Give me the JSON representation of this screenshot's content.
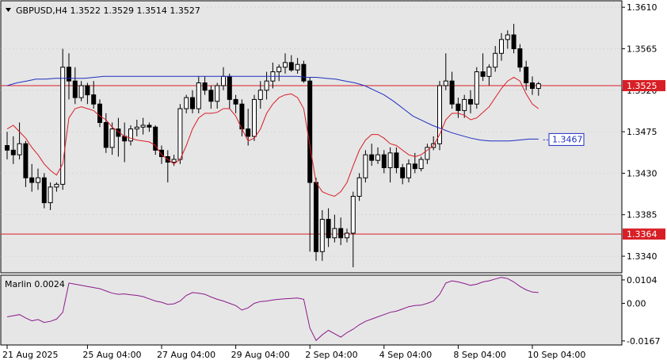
{
  "header": {
    "symbol_info": "GBPUSD,H4  1.3522 1.3529 1.3514 1.3527",
    "menu_icon": "triangle-down-icon"
  },
  "indicator": {
    "name": "Marlin 0.0024"
  },
  "colors": {
    "background": "#e6e6e6",
    "bull_candle": "#ffffff",
    "bear_candle": "#000000",
    "ma_blue": "#1f2fbf",
    "ma_red": "#d81f26",
    "hline": "#d81f26",
    "osc": "#8b1a8b",
    "grid": "#c8c8c8"
  },
  "chart_data": [
    {
      "type": "candlestick",
      "symbol": "GBPUSD",
      "timeframe": "H4",
      "ylim": [
        1.3322,
        1.3617
      ],
      "y_ticks": [
        "1.3610",
        "1.3565",
        "1.3520",
        "1.3475",
        "1.3430",
        "1.3385",
        "1.3340"
      ],
      "x_ticks": [
        {
          "label": "21 Aug 2025",
          "i": 0
        },
        {
          "label": "25 Aug 04:00",
          "i": 13
        },
        {
          "label": "27 Aug 04:00",
          "i": 25
        },
        {
          "label": "29 Aug 04:00",
          "i": 37
        },
        {
          "label": "2 Sep 04:00",
          "i": 49
        },
        {
          "label": "4 Sep 04:00",
          "i": 61
        },
        {
          "label": "8 Sep 04:00",
          "i": 73
        },
        {
          "label": "10 Sep 04:00",
          "i": 85
        }
      ],
      "candles": [
        [
          1.346,
          1.3475,
          1.3445,
          1.3455
        ],
        [
          1.3455,
          1.347,
          1.344,
          1.345
        ],
        [
          1.345,
          1.3485,
          1.3445,
          1.3462
        ],
        [
          1.3462,
          1.3465,
          1.3415,
          1.3425
        ],
        [
          1.3425,
          1.344,
          1.341,
          1.342
        ],
        [
          1.342,
          1.3435,
          1.3412,
          1.3425
        ],
        [
          1.3425,
          1.343,
          1.3392,
          1.3398
        ],
        [
          1.3398,
          1.342,
          1.339,
          1.3415
        ],
        [
          1.3415,
          1.342,
          1.341,
          1.3418
        ],
        [
          1.3418,
          1.3565,
          1.3412,
          1.3545
        ],
        [
          1.3545,
          1.356,
          1.351,
          1.353
        ],
        [
          1.353,
          1.3545,
          1.3505,
          1.3512
        ],
        [
          1.3512,
          1.353,
          1.3508,
          1.3525
        ],
        [
          1.3525,
          1.3528,
          1.3505,
          1.3515
        ],
        [
          1.3515,
          1.353,
          1.35,
          1.3505
        ],
        [
          1.3505,
          1.351,
          1.348,
          1.3485
        ],
        [
          1.3485,
          1.3495,
          1.3452,
          1.3458
        ],
        [
          1.3458,
          1.3485,
          1.345,
          1.3478
        ],
        [
          1.3478,
          1.349,
          1.3448,
          1.347
        ],
        [
          1.347,
          1.3485,
          1.3442,
          1.3465
        ],
        [
          1.3465,
          1.3482,
          1.346,
          1.3478
        ],
        [
          1.3478,
          1.3488,
          1.347,
          1.348
        ],
        [
          1.348,
          1.349,
          1.3472,
          1.3482
        ],
        [
          1.3482,
          1.3485,
          1.3475,
          1.348
        ],
        [
          1.348,
          1.3482,
          1.345,
          1.3455
        ],
        [
          1.3455,
          1.346,
          1.344,
          1.3448
        ],
        [
          1.3448,
          1.3455,
          1.342,
          1.3442
        ],
        [
          1.3442,
          1.345,
          1.3438,
          1.3445
        ],
        [
          1.3445,
          1.3505,
          1.344,
          1.35
        ],
        [
          1.35,
          1.3515,
          1.3495,
          1.3512
        ],
        [
          1.3512,
          1.352,
          1.3495,
          1.35
        ],
        [
          1.35,
          1.3535,
          1.3495,
          1.3528
        ],
        [
          1.3528,
          1.3535,
          1.3515,
          1.352
        ],
        [
          1.352,
          1.3525,
          1.35,
          1.3508
        ],
        [
          1.3508,
          1.3528,
          1.35,
          1.3525
        ],
        [
          1.3525,
          1.3545,
          1.352,
          1.3535
        ],
        [
          1.3535,
          1.3538,
          1.35,
          1.351
        ],
        [
          1.351,
          1.3515,
          1.3495,
          1.3505
        ],
        [
          1.3505,
          1.351,
          1.347,
          1.3478
        ],
        [
          1.3478,
          1.35,
          1.346,
          1.347
        ],
        [
          1.347,
          1.3515,
          1.3465,
          1.351
        ],
        [
          1.351,
          1.353,
          1.35,
          1.352
        ],
        [
          1.352,
          1.354,
          1.351,
          1.353
        ],
        [
          1.353,
          1.355,
          1.3522,
          1.354
        ],
        [
          1.354,
          1.3548,
          1.353,
          1.3545
        ],
        [
          1.3545,
          1.356,
          1.3538,
          1.355
        ],
        [
          1.355,
          1.3558,
          1.354,
          1.3542
        ],
        [
          1.3542,
          1.3555,
          1.3538,
          1.3548
        ],
        [
          1.3548,
          1.3552,
          1.3528,
          1.353
        ],
        [
          1.353,
          1.3534,
          1.3345,
          1.342
        ],
        [
          1.342,
          1.3425,
          1.3335,
          1.3345
        ],
        [
          1.3345,
          1.339,
          1.3335,
          1.338
        ],
        [
          1.338,
          1.3392,
          1.335,
          1.336
        ],
        [
          1.336,
          1.3385,
          1.3355,
          1.337
        ],
        [
          1.337,
          1.3382,
          1.3352,
          1.336
        ],
        [
          1.336,
          1.337,
          1.3355,
          1.3365
        ],
        [
          1.3365,
          1.341,
          1.3328,
          1.3405
        ],
        [
          1.3405,
          1.343,
          1.34,
          1.3425
        ],
        [
          1.3425,
          1.3455,
          1.342,
          1.345
        ],
        [
          1.345,
          1.3462,
          1.3438,
          1.3444
        ],
        [
          1.3444,
          1.3458,
          1.344,
          1.345
        ],
        [
          1.345,
          1.3455,
          1.343,
          1.3436
        ],
        [
          1.3436,
          1.3458,
          1.342,
          1.3452
        ],
        [
          1.3452,
          1.3458,
          1.343,
          1.3436
        ],
        [
          1.3436,
          1.344,
          1.3418,
          1.3425
        ],
        [
          1.3425,
          1.3445,
          1.342,
          1.344
        ],
        [
          1.344,
          1.3452,
          1.343,
          1.3435
        ],
        [
          1.3435,
          1.3448,
          1.3432,
          1.3445
        ],
        [
          1.3445,
          1.3462,
          1.344,
          1.3458
        ],
        [
          1.3458,
          1.347,
          1.3455,
          1.3462
        ],
        [
          1.3462,
          1.353,
          1.3455,
          1.3525
        ],
        [
          1.3525,
          1.356,
          1.352,
          1.353
        ],
        [
          1.353,
          1.354,
          1.35,
          1.3505
        ],
        [
          1.3505,
          1.3512,
          1.349,
          1.3498
        ],
        [
          1.3498,
          1.3515,
          1.349,
          1.351
        ],
        [
          1.351,
          1.352,
          1.3495,
          1.3505
        ],
        [
          1.3505,
          1.3545,
          1.35,
          1.354
        ],
        [
          1.354,
          1.356,
          1.353,
          1.3535
        ],
        [
          1.3535,
          1.3548,
          1.3525,
          1.3545
        ],
        [
          1.3545,
          1.3568,
          1.354,
          1.356
        ],
        [
          1.356,
          1.3582,
          1.3552,
          1.3575
        ],
        [
          1.3575,
          1.3585,
          1.3565,
          1.358
        ],
        [
          1.358,
          1.3592,
          1.356,
          1.3565
        ],
        [
          1.3565,
          1.357,
          1.354,
          1.3545
        ],
        [
          1.3545,
          1.3552,
          1.352,
          1.3528
        ],
        [
          1.3528,
          1.3535,
          1.3515,
          1.3522
        ],
        [
          1.3522,
          1.3529,
          1.3514,
          1.3527
        ]
      ],
      "ma_blue": [
        1.3525,
        1.3528,
        1.353,
        1.3532,
        1.3532,
        1.3533,
        1.3533,
        1.3533,
        1.3533,
        1.3534,
        1.3535,
        1.3535,
        1.3535,
        1.3535,
        1.3535,
        1.3535,
        1.3535,
        1.3535,
        1.3535,
        1.3535,
        1.3535,
        1.3535,
        1.3535,
        1.3535,
        1.3535,
        1.3535,
        1.3535,
        1.3535,
        1.3535,
        1.3535,
        1.3535,
        1.3534,
        1.3534,
        1.3533,
        1.3532,
        1.353,
        1.3528,
        1.3525,
        1.352,
        1.3515,
        1.3508,
        1.35,
        1.3492,
        1.3487,
        1.3482,
        1.3478,
        1.3474,
        1.3471,
        1.3468,
        1.3466,
        1.3465,
        1.3465,
        1.3465,
        1.3466,
        1.3467,
        1.3467
      ],
      "ma_red": [
        1.3478,
        1.3482,
        1.3475,
        1.3468,
        1.3458,
        1.345,
        1.344,
        1.3433,
        1.3428,
        1.344,
        1.349,
        1.35,
        1.3502,
        1.35,
        1.3498,
        1.3492,
        1.3488,
        1.348,
        1.3475,
        1.347,
        1.3468,
        1.3466,
        1.3465,
        1.3464,
        1.346,
        1.345,
        1.3445,
        1.344,
        1.3445,
        1.346,
        1.3478,
        1.349,
        1.3495,
        1.3495,
        1.3496,
        1.35,
        1.35,
        1.3492,
        1.3478,
        1.3465,
        1.3468,
        1.3478,
        1.3495,
        1.3505,
        1.3512,
        1.3515,
        1.3516,
        1.3512,
        1.35,
        1.346,
        1.342,
        1.341,
        1.3407,
        1.3405,
        1.341,
        1.342,
        1.3438,
        1.3455,
        1.3466,
        1.3472,
        1.3472,
        1.3468,
        1.3462,
        1.346,
        1.3455,
        1.345,
        1.3448,
        1.345,
        1.3455,
        1.346,
        1.3472,
        1.3488,
        1.3495,
        1.3495,
        1.3493,
        1.3488,
        1.349,
        1.3496,
        1.3502,
        1.3512,
        1.3522,
        1.353,
        1.3534,
        1.353,
        1.3516,
        1.3505,
        1.35
      ],
      "hlines": [
        {
          "value": 1.3525,
          "label": "1.3525"
        },
        {
          "value": 1.3364,
          "label": "1.3364"
        }
      ],
      "ma_label": "1.3467"
    },
    {
      "type": "line",
      "name": "Marlin 0.0024",
      "ylim": [
        -0.0185,
        0.0125
      ],
      "y_ticks": [
        "0.0104",
        "0.00",
        "-0.0167"
      ],
      "values": [
        -0.006,
        -0.0055,
        -0.005,
        -0.0065,
        -0.0078,
        -0.0072,
        -0.0085,
        -0.008,
        -0.007,
        -0.004,
        0.009,
        0.0085,
        0.008,
        0.0075,
        0.007,
        0.0065,
        0.0055,
        0.0045,
        0.004,
        0.0042,
        0.0038,
        0.0035,
        0.003,
        0.002,
        0.001,
        0.0005,
        -0.0005,
        -0.0002,
        0.001,
        0.0035,
        0.0048,
        0.0045,
        0.004,
        0.0028,
        0.0018,
        0.001,
        0.0,
        -0.001,
        -0.003,
        -0.002,
        0.0,
        0.0008,
        0.001,
        0.0015,
        0.0018,
        0.002,
        0.0022,
        0.0024,
        0.0018,
        -0.011,
        -0.0165,
        -0.014,
        -0.012,
        -0.0135,
        -0.015,
        -0.013,
        -0.0115,
        -0.0095,
        -0.008,
        -0.007,
        -0.006,
        -0.005,
        -0.004,
        -0.0035,
        -0.0025,
        -0.0015,
        -0.001,
        -0.0008,
        0.0,
        0.001,
        0.004,
        0.009,
        0.01,
        0.0095,
        0.0088,
        0.008,
        0.0085,
        0.0095,
        0.01,
        0.0108,
        0.0115,
        0.011,
        0.0095,
        0.0075,
        0.006,
        0.005,
        0.0048
      ]
    }
  ]
}
